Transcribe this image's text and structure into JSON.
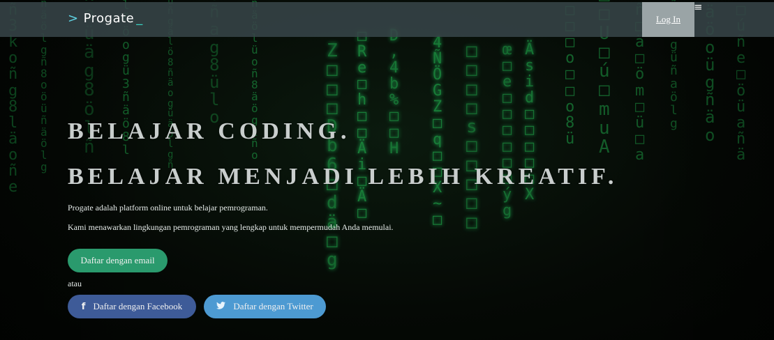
{
  "header": {
    "logo_prefix": ">",
    "logo_text": "Progate",
    "logo_cursor": "_",
    "login_label": "Log In",
    "menu_icon": "≡"
  },
  "hero": {
    "headline_1": "BELAJAR CODING.",
    "headline_2": "BELAJAR MENJADI LEBIH KREATIF.",
    "description_1": "Progate adalah platform online untuk belajar pemrograman.",
    "description_2": "Kami menawarkan lingkungan pemrograman yang lengkap untuk mempermudah Anda memulai.",
    "email_button": "Daftar dengan email",
    "separator": "atau",
    "facebook_button": "Daftar dengan Facebook",
    "twitter_button": "Daftar dengan Twitter",
    "facebook_icon": "f",
    "twitter_icon": "🐦"
  },
  "colors": {
    "header_bg": "#374448",
    "email_button": "#2a9a6d",
    "facebook_button": "#3e5b98",
    "twitter_button": "#4d9ad2",
    "matrix_green": "#1fa84a"
  }
}
